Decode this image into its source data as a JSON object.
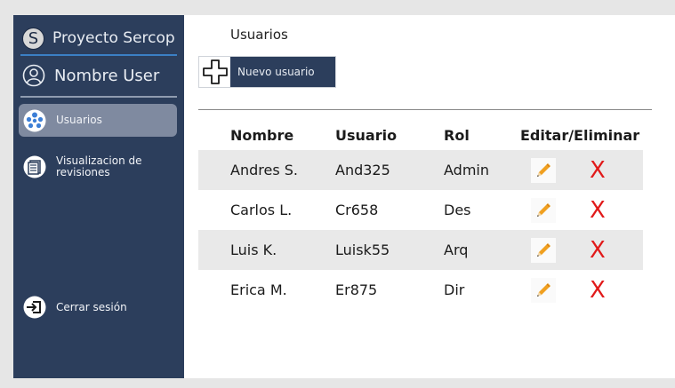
{
  "sidebar": {
    "brand_letter": "S",
    "brand": "Proyecto Sercop",
    "user": "Nombre User",
    "items": [
      {
        "label": "Usuarios",
        "icon": "users-icon",
        "active": true
      },
      {
        "label": "Visualizacion de revisiones",
        "icon": "document-icon",
        "active": false
      }
    ],
    "logout": "Cerrar sesión"
  },
  "main": {
    "title": "Usuarios",
    "new_user_label": "Nuevo usuario",
    "columns": [
      "Nombre",
      "Usuario",
      "Rol",
      "Editar/Eliminar"
    ],
    "rows": [
      {
        "nombre": "Andres S.",
        "usuario": "And325",
        "rol": "Admin"
      },
      {
        "nombre": "Carlos L.",
        "usuario": "Cr658",
        "rol": "Des"
      },
      {
        "nombre": "Luis K.",
        "usuario": "Luisk55",
        "rol": "Arq"
      },
      {
        "nombre": "Erica M.",
        "usuario": "Er875",
        "rol": "Dir"
      }
    ],
    "delete_symbol": "X"
  },
  "colors": {
    "sidebar": "#2c3e5c",
    "active_item": "#7f8aa0",
    "accent_line": "#3b7fc4",
    "delete": "#e11a1a",
    "edit_pencil": "#f0a020"
  }
}
